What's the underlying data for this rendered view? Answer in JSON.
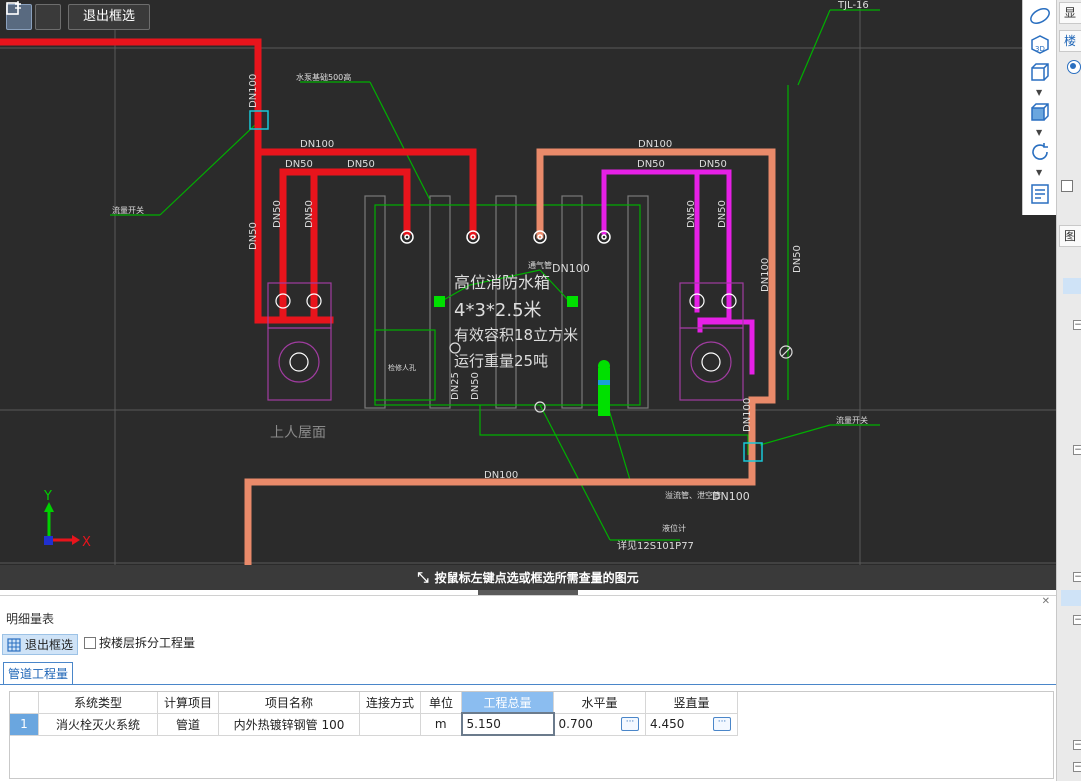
{
  "toolbar": {
    "exit_box_select_label": "退出框选"
  },
  "canvas": {
    "hint": "按鼠标左键点选或框选所需查量的图元",
    "axis_x": "X",
    "axis_y": "Y",
    "labels": {
      "top_right_riser": "TJL-16",
      "top_left_tag": "DN100",
      "note_tank_label": "高位消防水箱",
      "tank_dim": "4*3*2.5米",
      "tank_volume": "有效容积18立方米",
      "tank_weight": "运行重量25吨",
      "vent_label": "通气管",
      "vent_dn": "DN100",
      "overflow_label": "溢流管、泄空管",
      "overflow_dn": "DN100",
      "ref_standard": "详见12S101P77",
      "level_gauge": "液位计",
      "roof_access": "上人屋面",
      "top_left_note": "水泵基础500高",
      "left_callout": "流量开关",
      "right_callout": "流量开关",
      "small_tag": "检修人孔",
      "dn100_top_left": "DN100",
      "dn100_top_right": "DN100",
      "dn100_bottom": "DN100",
      "dn100_right_vertical": "DN100",
      "dn100_left_vertical": "DN100",
      "dn100_lower_right": "DN100",
      "dn50_a": "DN50",
      "dn50_b": "DN50",
      "dn50_c": "DN50",
      "dn50_d": "DN50",
      "dn50_left": "DN50",
      "dn50_v1": "DN50",
      "dn50_v2": "DN50",
      "dn50_v3": "DN50",
      "dn50_v4": "DN50",
      "dn50_right": "DN50",
      "dn25": "DN25",
      "dn50_mid": "DN50"
    }
  },
  "detail_panel": {
    "title": "明细量表",
    "exit_box_select_label": "退出框选",
    "split_by_floor_label": "按楼层拆分工程量",
    "tab_label": "管道工程量",
    "columns": [
      "系统类型",
      "计算项目",
      "项目名称",
      "连接方式",
      "单位",
      "工程总量",
      "水平量",
      "竖直量"
    ],
    "rows": [
      {
        "index": "1",
        "system_type": "消火栓灭火系统",
        "calc_item": "管道",
        "item_name": "内外热镀锌钢管 100",
        "connection": "",
        "unit": "m",
        "total": "5.150",
        "horizontal": "0.700",
        "vertical": "4.450"
      }
    ]
  },
  "right_panel": {
    "tab1": "显",
    "tab2": "楼",
    "tab3": "图"
  },
  "colors": {
    "pipe_red": "#e8141c",
    "pipe_salmon": "#e98a6a",
    "pipe_magenta": "#e620e6",
    "green_markers": "#00e000",
    "selected_header": "#8bbdf0"
  }
}
